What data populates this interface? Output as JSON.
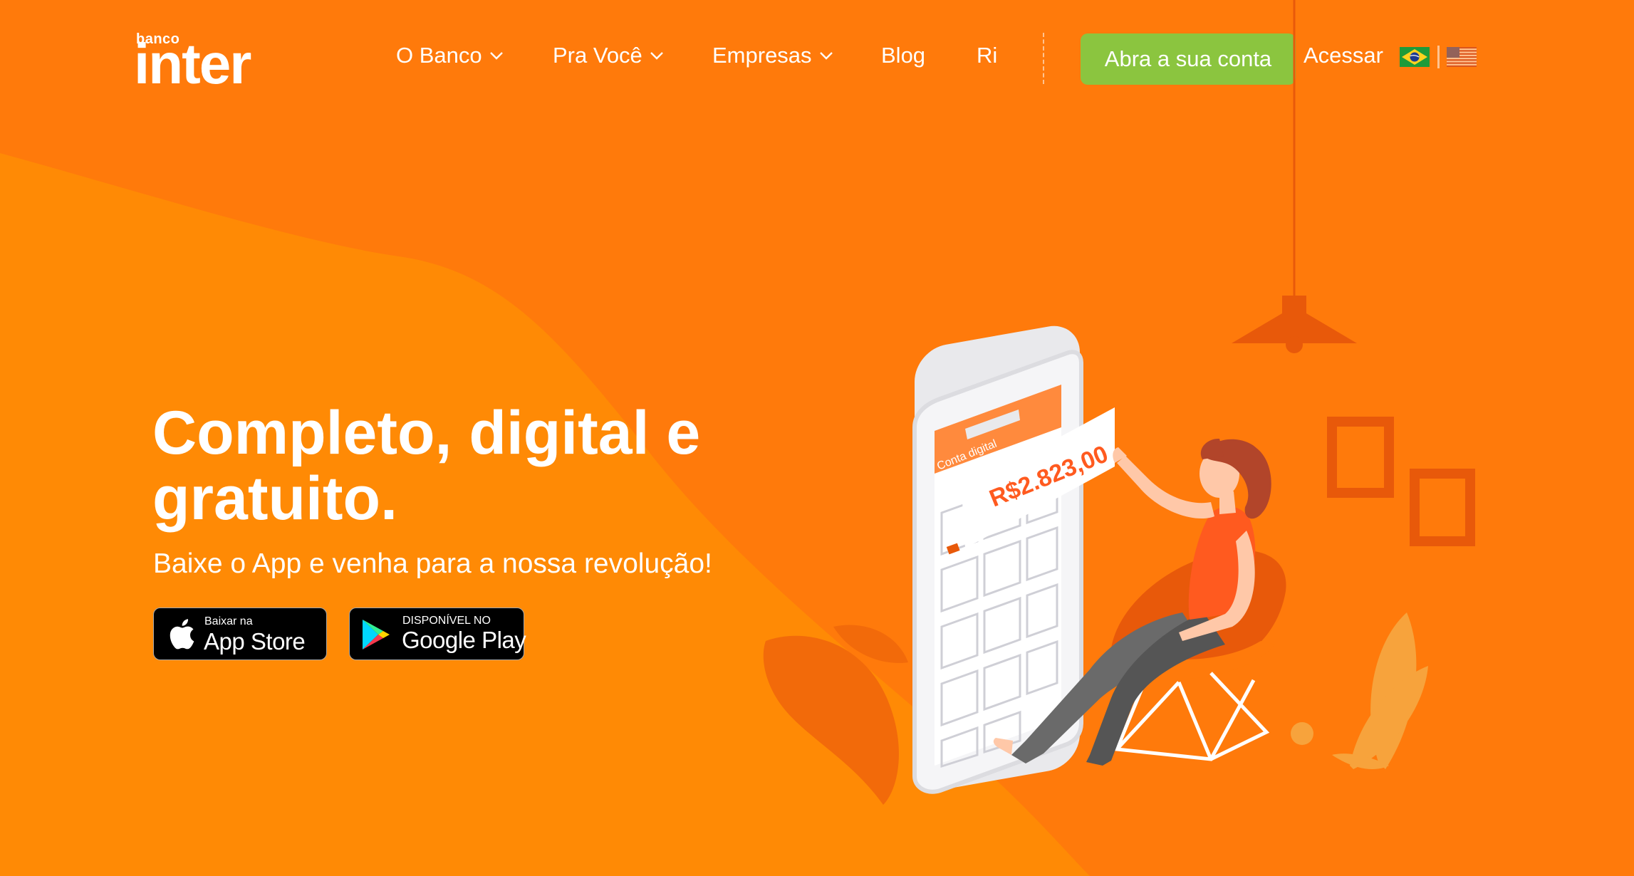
{
  "header": {
    "logo_small": "banco",
    "logo_big": "inter",
    "nav": [
      {
        "label": "O Banco",
        "dropdown": true
      },
      {
        "label": "Pra Você",
        "dropdown": true
      },
      {
        "label": "Empresas",
        "dropdown": true
      },
      {
        "label": "Blog",
        "dropdown": false
      },
      {
        "label": "Ri",
        "dropdown": false
      }
    ],
    "cta_label": "Abra a sua conta",
    "access_label": "Acessar",
    "languages": [
      "brazil-flag-icon",
      "usa-flag-icon"
    ]
  },
  "hero": {
    "title": "Completo, digital e gratuito.",
    "subtitle": "Baixe o App e venha para a nossa revolução!",
    "app_store": {
      "small": "Baixar na",
      "big": "App Store",
      "icon": "apple-icon"
    },
    "google_play": {
      "small": "DISPONÍVEL NO",
      "big": "Google Play",
      "icon": "google-play-icon"
    }
  },
  "illustration": {
    "screen_title": "Conta digital",
    "balance": "R$2.823,00"
  },
  "colors": {
    "background": "#ff7a0b",
    "wave": "#ff8a05",
    "cta": "#8bc53f",
    "dark_orange": "#e8590a"
  }
}
